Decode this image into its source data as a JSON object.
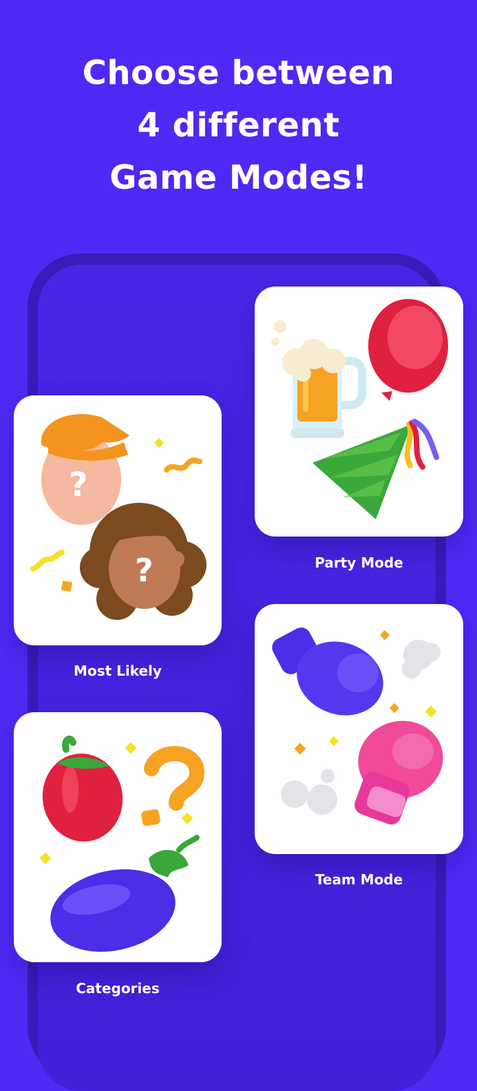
{
  "headline": {
    "line1": "Choose between",
    "line2": "4 different",
    "line3": "Game Modes!"
  },
  "modes": [
    {
      "label": "Party Mode",
      "icon": "party-icon"
    },
    {
      "label": "Most Likely",
      "icon": "faces-icon"
    },
    {
      "label": "Team Mode",
      "icon": "boxing-gloves-icon"
    },
    {
      "label": "Categories",
      "icon": "vegetables-icon"
    }
  ],
  "colors": {
    "background": "#5028f4",
    "phone_frame": "#3a1ab8",
    "card": "#ffffff",
    "text": "#ffffff"
  }
}
